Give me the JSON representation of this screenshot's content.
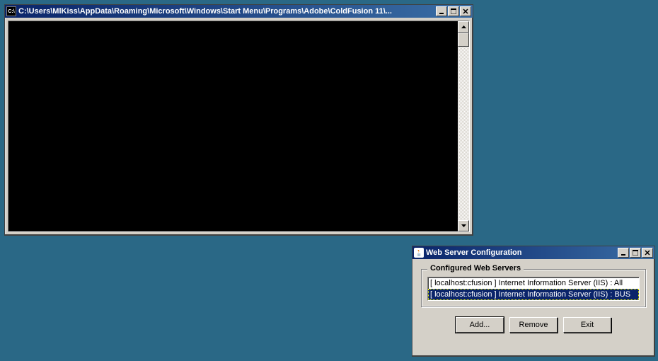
{
  "console": {
    "icon_text": "C:\\",
    "title": "C:\\Users\\MlKiss\\AppData\\Roaming\\Microsoft\\Windows\\Start Menu\\Programs\\Adobe\\ColdFusion 11\\..."
  },
  "config": {
    "title": "Web Server Configuration",
    "group_label": "Configured Web Servers",
    "items": [
      {
        "text": "[ localhost:cfusion ] Internet Information Server (IIS) : All",
        "selected": false
      },
      {
        "text": "[ localhost:cfusion ] Internet Information Server (IIS) : BUS",
        "selected": true
      }
    ],
    "buttons": {
      "add": "Add...",
      "remove": "Remove",
      "exit": "Exit"
    }
  }
}
